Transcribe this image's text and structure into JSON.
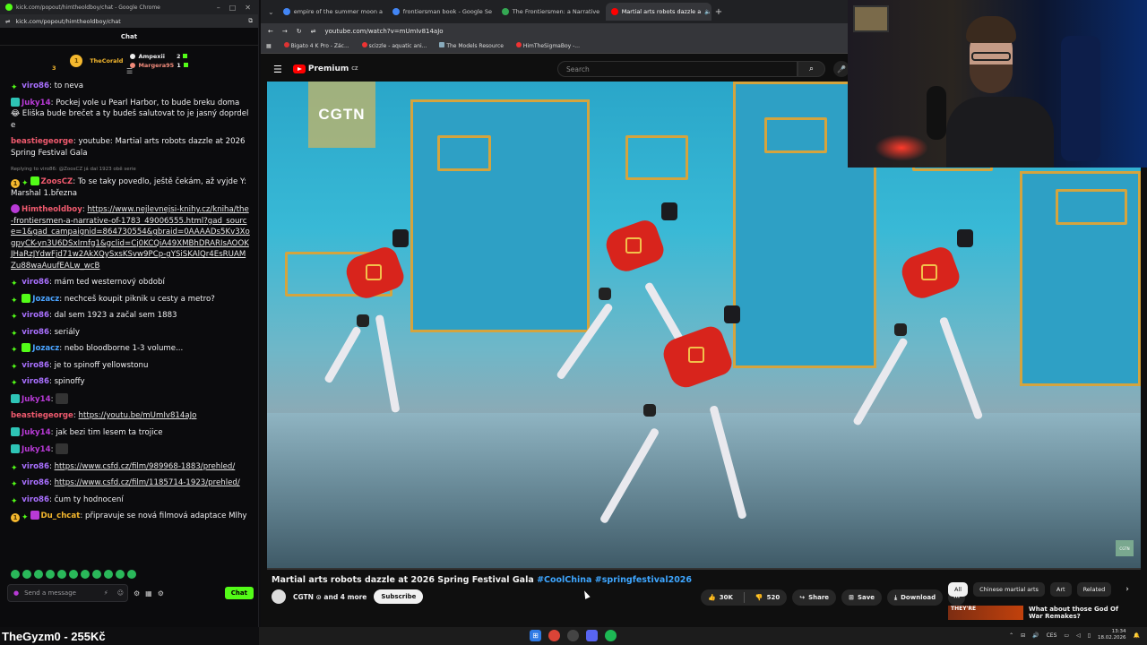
{
  "chat_window": {
    "title": "kick.com/popout/himtheoldboy/chat - Google Chrome",
    "url": "kick.com/popout/himtheoldboy/chat",
    "header": "Chat",
    "leaderboard": [
      {
        "rank": "1",
        "name": "TheCorald",
        "count": "3",
        "color": "#f5b82e"
      },
      {
        "name": "Ampexii",
        "count": "2",
        "color": "#ffffff"
      },
      {
        "name": "Margera95",
        "count": "1",
        "color": "#f08a7a"
      }
    ],
    "messages": [
      {
        "user": "viro86",
        "color": "#a970ff",
        "text": "to neva"
      },
      {
        "user": "Juky14",
        "color": "#b83ad6",
        "text": "Pockej vole u Pearl Harbor, to bude breku doma 😂 Eliška bude brečet a ty budeš salutovat to je jasný doprdele"
      },
      {
        "user": "beastiegeorge",
        "color": "#f05a6e",
        "text": "youtube: Martial arts robots dazzle at 2026 Spring Festival Gala"
      },
      {
        "reply": "Replying to viro86: @ZoosCZ já dal 1923 obě serie",
        "user": "ZoosCZ",
        "color": "#f05a6e",
        "text": "To se taky povedlo, ještě čekám, až vyjde Y:Marshal 1.března"
      },
      {
        "user": "Himtheoldboy",
        "color": "#f05a6e",
        "link": "https://www.nejlevnejsi-knihy.cz/kniha/the-frontiersmen-a-narrative-of-1783_49006555.html?gad_source=1&gad_campaignid=864730554&gbraid=0AAAADs5Kv3XogpyCK-yn3U6DSxIrnfg1&gclid=Cj0KCQiA49XMBhDRARIsAOOKJHaRzJYdwFjd71w2AkXQySxsKSvw9PCp-gYSiSKAlQr4EsRUAMZu88waAuufEALw_wcB"
      },
      {
        "user": "viro86",
        "color": "#a970ff",
        "text": "mám ted westernový období"
      },
      {
        "user": "Jozacz",
        "color": "#4aa3ff",
        "text": "nechceš koupit piknik u cesty a metro?"
      },
      {
        "user": "viro86",
        "color": "#a970ff",
        "text": "dal sem 1923 a začal sem 1883"
      },
      {
        "user": "viro86",
        "color": "#a970ff",
        "text": "seriály"
      },
      {
        "user": "Jozacz",
        "color": "#4aa3ff",
        "text": "nebo bloodborne 1-3 volume..."
      },
      {
        "user": "viro86",
        "color": "#a970ff",
        "text": "je to spinoff yellowstonu"
      },
      {
        "user": "viro86",
        "color": "#a970ff",
        "text": "spinoffy"
      },
      {
        "user": "Juky14",
        "color": "#b83ad6",
        "text": ""
      },
      {
        "user": "beastiegeorge",
        "color": "#f05a6e",
        "link": "https://youtu.be/mUmIv814aJo"
      },
      {
        "user": "Juky14",
        "color": "#b83ad6",
        "text": "jak bezi tim lesem ta trojice"
      },
      {
        "user": "Juky14",
        "color": "#b83ad6",
        "text": ""
      },
      {
        "user": "viro86",
        "color": "#a970ff",
        "link": "https://www.csfd.cz/film/989968-1883/prehled/"
      },
      {
        "user": "viro86",
        "color": "#a970ff",
        "link": "https://www.csfd.cz/film/1185714-1923/prehled/"
      },
      {
        "user": "viro86",
        "color": "#a970ff",
        "text": "čum ty hodnocení"
      },
      {
        "user": "Du_chcat",
        "color": "#f5b82e",
        "text": "připravuje se nová filmová adaptace Mlhy"
      }
    ],
    "input_placeholder": "Send a message",
    "send_label": "Chat"
  },
  "streamer_overlay": "TheGyzm0 - 255Kč",
  "browser": {
    "tabs": [
      {
        "label": "empire of the summer moon a",
        "color": "#4285f4"
      },
      {
        "label": "frontiersman book - Google Se",
        "color": "#4285f4"
      },
      {
        "label": "The Frontiersmen: a Narrative",
        "color": "#34a853"
      },
      {
        "label": "Martial arts robots dazzle a",
        "color": "#ff0000",
        "active": true
      }
    ],
    "url": "youtube.com/watch?v=mUmIv814aJo",
    "bookmarks": [
      "Bigato 4 K Pro - Zác...",
      "scizzle - aquatic ani...",
      "The Models Resource",
      "HimTheSigmaBoy -..."
    ]
  },
  "youtube": {
    "logo": "Premium",
    "region": "CZ",
    "search_placeholder": "Search",
    "video_watermark": "CGTN",
    "video_corner_logo": "CGTN",
    "title": "Martial arts robots dazzle at 2026 Spring Festival Gala",
    "hashtags": "#CoolChina #springfestival2026",
    "channel": "CGTN ⊙ and 4 more",
    "subscribe": "Subscribe",
    "likes": "30K",
    "dislikes": "520",
    "share": "Share",
    "save": "Save",
    "download": "Download",
    "chips": [
      "All",
      "Chinese martial arts",
      "Art",
      "Related"
    ],
    "recommended": {
      "thumb_text": "THEY'RE",
      "title": "What about those God Of War Remakes?"
    }
  },
  "taskbar": {
    "language": "CES",
    "time": "13:34",
    "date": "18.02.2026"
  },
  "colors": {
    "kick_green": "#53fc18",
    "youtube_red": "#ff0000",
    "link_blue": "#3ea6ff"
  }
}
